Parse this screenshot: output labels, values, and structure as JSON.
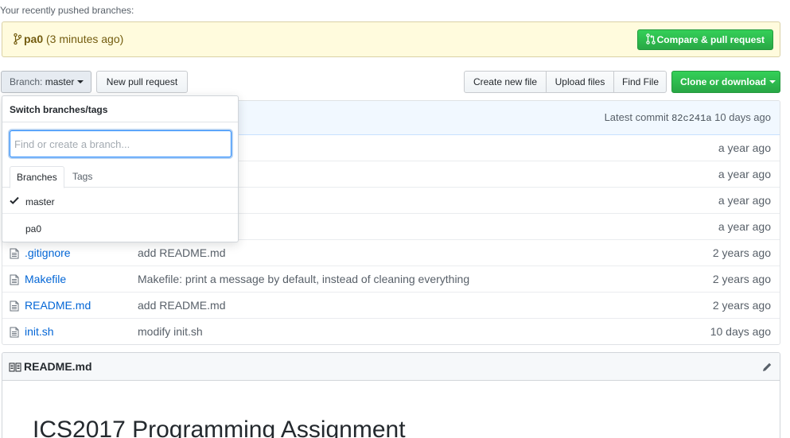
{
  "recent_push": {
    "label": "Your recently pushed branches:",
    "branch": "pa0",
    "time": "(3 minutes ago)",
    "compare_button": "Compare & pull request"
  },
  "toolbar": {
    "branch_prefix": "Branch:",
    "branch_name": "master",
    "new_pr": "New pull request",
    "create_file": "Create new file",
    "upload_files": "Upload files",
    "find_file": "Find File",
    "clone": "Clone or download"
  },
  "commit_bar": {
    "latest_commit_label": "Latest commit",
    "sha": "82c241a",
    "age": "10 days ago"
  },
  "files": [
    {
      "name": "",
      "message": "",
      "age": "a year ago"
    },
    {
      "name": "",
      "message": "",
      "age": "a year ago"
    },
    {
      "name": "",
      "message": "",
      "age": "a year ago"
    },
    {
      "name": "",
      "message": "",
      "age": "a year ago"
    },
    {
      "name": ".gitignore",
      "message": "add README.md",
      "age": "2 years ago"
    },
    {
      "name": "Makefile",
      "message": "Makefile: print a message by default, instead of cleaning everything",
      "age": "2 years ago"
    },
    {
      "name": "README.md",
      "message": "add README.md",
      "age": "2 years ago"
    },
    {
      "name": "init.sh",
      "message": "modify init.sh",
      "age": "10 days ago"
    }
  ],
  "readme": {
    "title": "README.md",
    "heading": "ICS2017 Programming Assignment"
  },
  "dropdown": {
    "title": "Switch branches/tags",
    "filter_placeholder": "Find or create a branch...",
    "tabs": [
      "Branches",
      "Tags"
    ],
    "branches": [
      "master",
      "pa0"
    ]
  },
  "colors": {
    "accent_green": "#28a745",
    "link_blue": "#0366d6",
    "banner_yellow": "#fffbdd"
  }
}
